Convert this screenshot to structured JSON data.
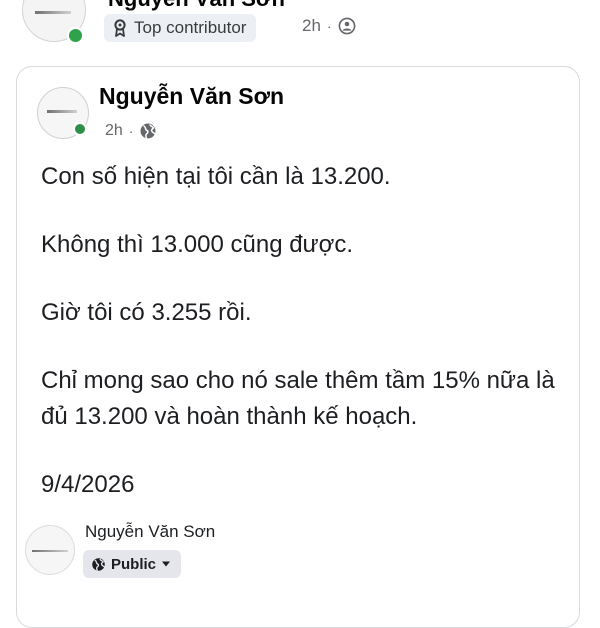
{
  "outer_post": {
    "author_name": "Nguyễn Văn Sơn",
    "badge_label": "Top contributor",
    "time": "2h",
    "separator": "·",
    "audience_icon": "group-icon"
  },
  "shared_post": {
    "author_name": "Nguyễn Văn Sơn",
    "time": "2h",
    "separator": "·",
    "audience_icon": "globe-icon",
    "paragraphs": [
      "Con số hiện tại tôi cần là 13.200.",
      "Không thì 13.000 cũng được.",
      "Giờ tôi có 3.255 rồi.",
      "Chỉ mong sao cho nó sale thêm tầm 15% nữa là đủ 13.200 và hoàn thành kế hoạch.",
      "9/4/2026"
    ]
  },
  "attached_preview": {
    "author_name": "Nguyễn Văn Sơn",
    "audience_label": "Public",
    "audience_icon": "globe-icon"
  },
  "colors": {
    "online_green": "#31a24c",
    "secondary_text": "#65676b",
    "badge_bg": "#eceff3",
    "button_bg": "#e4e6eb"
  }
}
